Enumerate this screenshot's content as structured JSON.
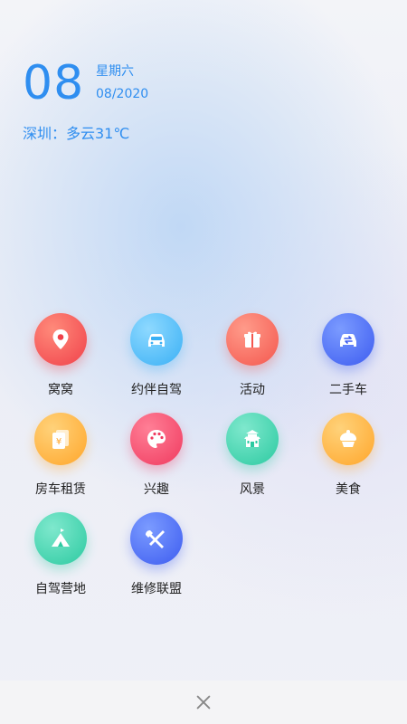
{
  "date": {
    "day": "08",
    "weekday": "星期六",
    "month_year": "08/2020"
  },
  "weather": {
    "text": "深圳：多云31℃"
  },
  "apps": [
    {
      "label": "窝窝",
      "icon": "location-pin-icon",
      "color_from": "#ff8a7a",
      "color_to": "#f0414a"
    },
    {
      "label": "约伴自驾",
      "icon": "car-icon",
      "color_from": "#8ed9ff",
      "color_to": "#3ab0f5"
    },
    {
      "label": "活动",
      "icon": "gift-icon",
      "color_from": "#ff9b8a",
      "color_to": "#f4574e"
    },
    {
      "label": "二手车",
      "icon": "car-exchange-icon",
      "color_from": "#7b9bff",
      "color_to": "#3d5cf0"
    },
    {
      "label": "房车租赁",
      "icon": "rental-document-icon",
      "color_from": "#ffd27a",
      "color_to": "#ffa62b"
    },
    {
      "label": "兴趣",
      "icon": "palette-icon",
      "color_from": "#ff7f96",
      "color_to": "#f03a5f"
    },
    {
      "label": "风景",
      "icon": "pagoda-icon",
      "color_from": "#7fe8cd",
      "color_to": "#2ccaa1"
    },
    {
      "label": "美食",
      "icon": "cupcake-icon",
      "color_from": "#ffd27a",
      "color_to": "#ffa62b"
    },
    {
      "label": "自驾营地",
      "icon": "tent-icon",
      "color_from": "#7fe8cd",
      "color_to": "#2ccaa1"
    },
    {
      "label": "维修联盟",
      "icon": "repair-tools-icon",
      "color_from": "#7b9bff",
      "color_to": "#3d5cf0"
    }
  ],
  "footer": {
    "close_icon": "close-icon"
  }
}
